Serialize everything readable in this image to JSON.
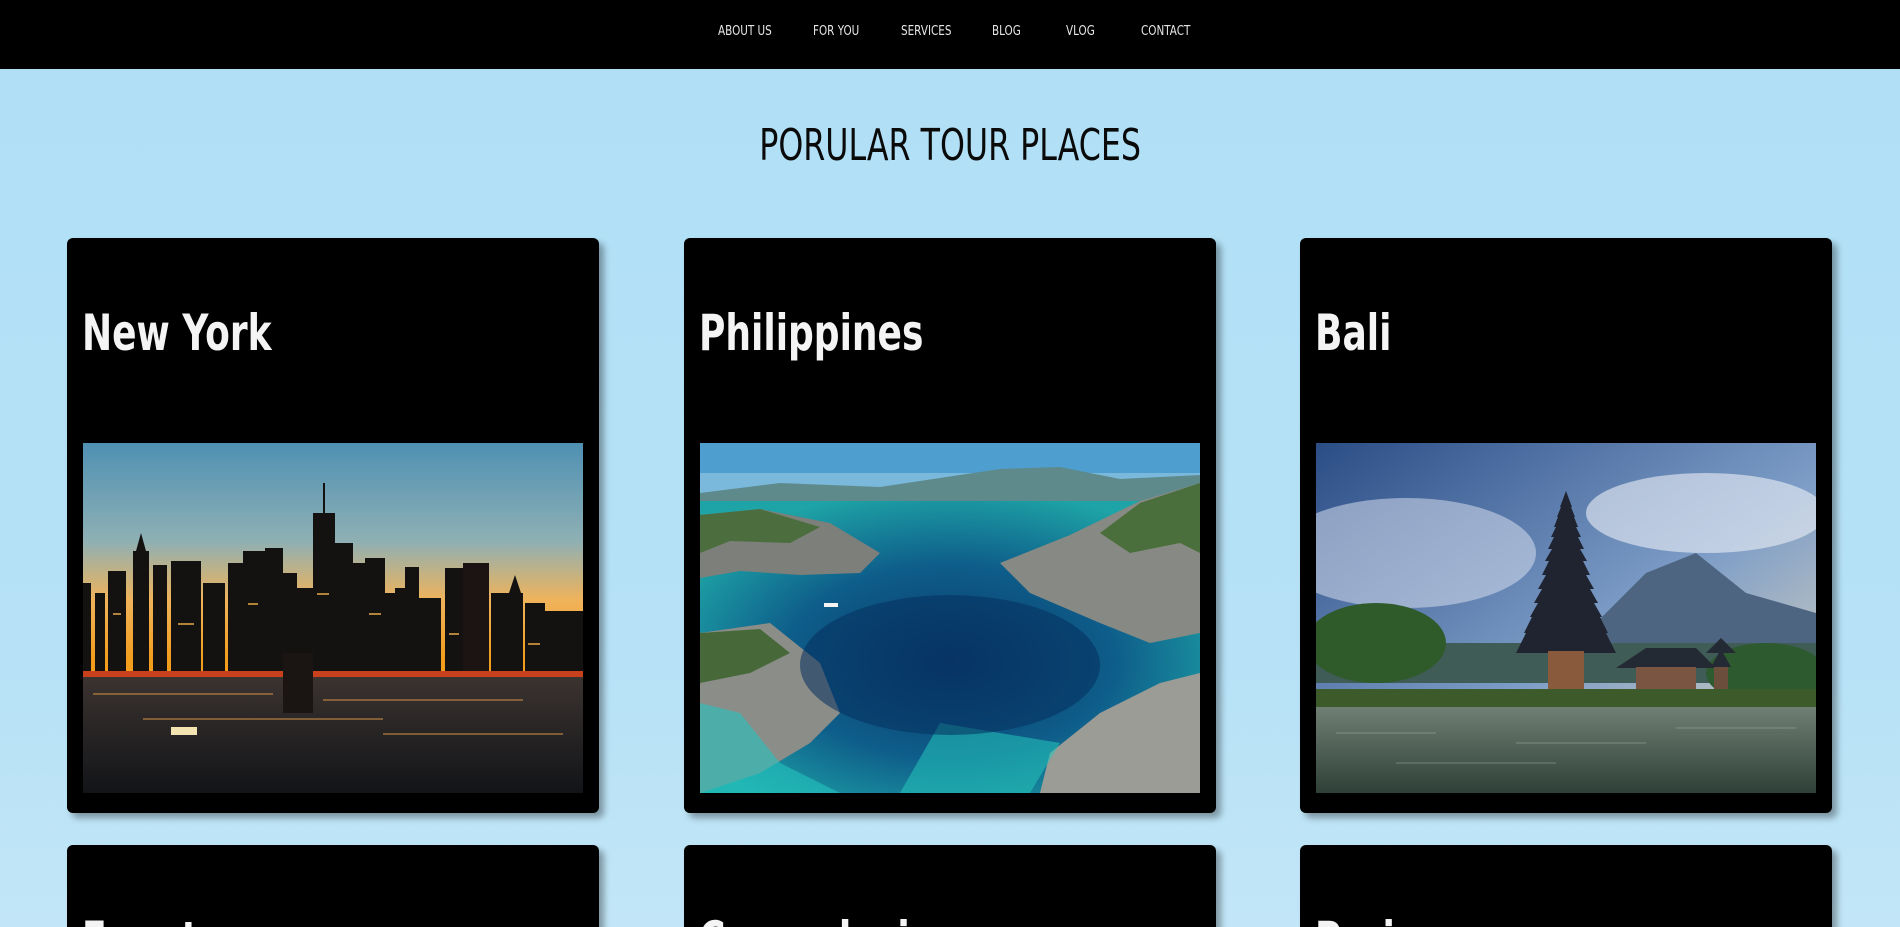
{
  "nav": {
    "items": [
      {
        "label": "ABOUT US"
      },
      {
        "label": "FOR YOU"
      },
      {
        "label": "SERVICES"
      },
      {
        "label": "BLOG"
      },
      {
        "label": "VLOG"
      },
      {
        "label": "CONTACT"
      }
    ]
  },
  "page": {
    "title": "PORULAR TOUR PLACES"
  },
  "cards": [
    {
      "title": "New York",
      "image": "new-york-skyline-sunset"
    },
    {
      "title": "Philippines",
      "image": "philippines-lagoon-aerial"
    },
    {
      "title": "Bali",
      "image": "bali-temple-lake"
    },
    {
      "title": "Egypt",
      "image": ""
    },
    {
      "title": "Cappadocia",
      "image": ""
    },
    {
      "title": "Paris",
      "image": ""
    }
  ],
  "colors": {
    "background": "#b3e0f6",
    "navbar": "#000000",
    "card": "#000000",
    "text_light": "#f4f4f4"
  }
}
